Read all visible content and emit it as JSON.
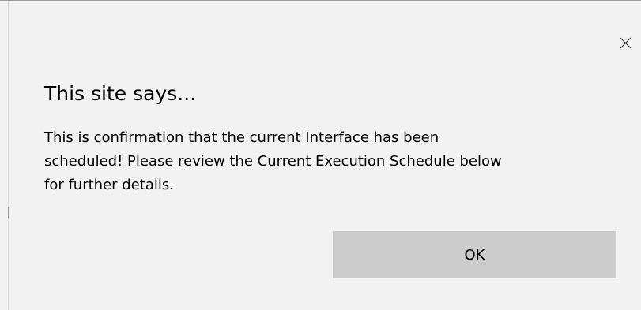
{
  "dialog": {
    "title": "This site says...",
    "message_lines": [
      "This is confirmation that the current Interface has been",
      "scheduled! Please review the Current Execution Schedule below",
      "for further details."
    ],
    "ok_label": "OK",
    "close_icon": "close-icon"
  },
  "colors": {
    "background": "#f2f2f2",
    "button": "#cccccc",
    "text": "#000000"
  }
}
